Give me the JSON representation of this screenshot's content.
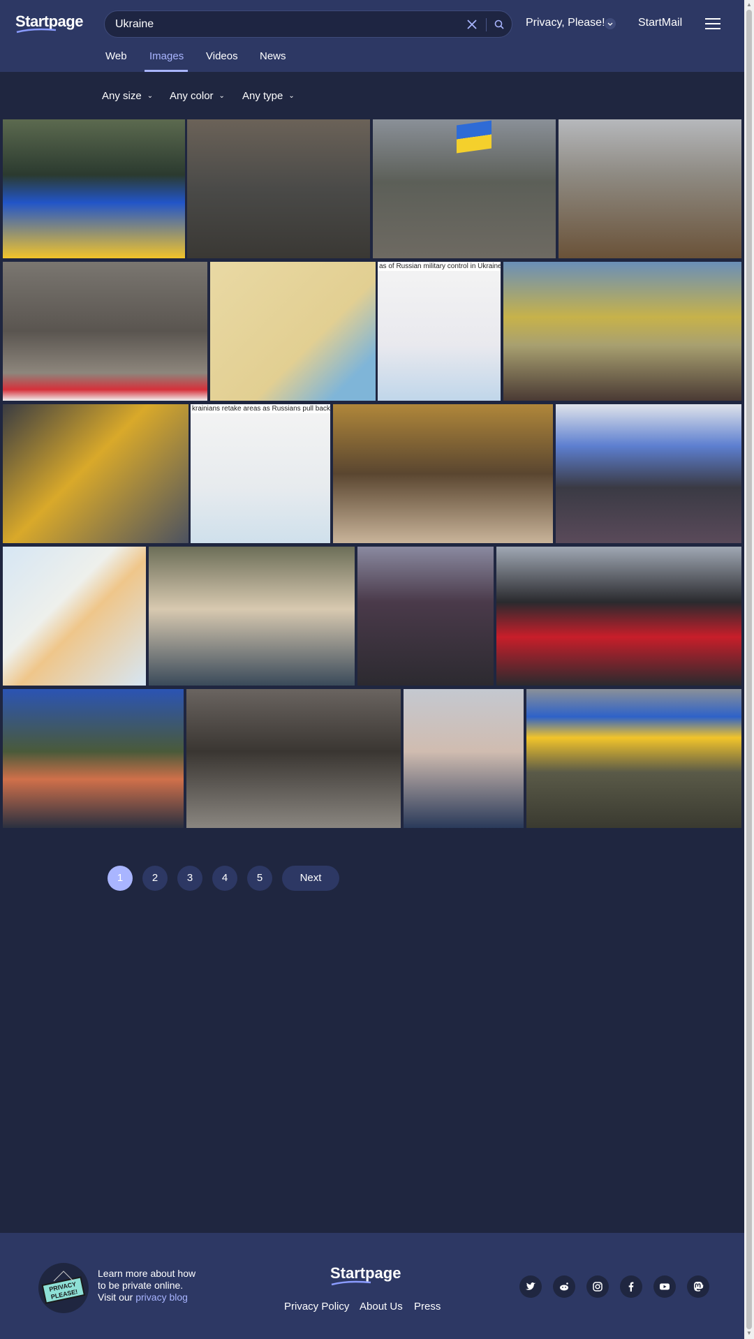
{
  "header": {
    "logo": "Startpage",
    "search": {
      "value": "Ukraine"
    },
    "privacy_menu": "Privacy, Please!",
    "startmail": "StartMail"
  },
  "tabs": [
    {
      "label": "Web",
      "active": false
    },
    {
      "label": "Images",
      "active": true
    },
    {
      "label": "Videos",
      "active": false
    },
    {
      "label": "News",
      "active": false
    }
  ],
  "filters": {
    "size": "Any size",
    "color": "Any color",
    "type": "Any type"
  },
  "images": {
    "map1_caption": "as of Russian military control in Ukraine",
    "map2_caption": "krainians retake areas as Russians pull back"
  },
  "pagination": {
    "pages": [
      "1",
      "2",
      "3",
      "4",
      "5"
    ],
    "current": "1",
    "next": "Next"
  },
  "footer": {
    "badge_text": "PRIVACY PLEASE!",
    "blurb_line1": "Learn more about how",
    "blurb_line2": "to be private online.",
    "blurb_line3": "Visit our",
    "blog_link": "privacy blog",
    "logo": "Startpage",
    "links": [
      "Privacy Policy",
      "About Us",
      "Press"
    ],
    "social_icons": [
      "twitter-icon",
      "reddit-icon",
      "instagram-icon",
      "facebook-icon",
      "youtube-icon",
      "mastodon-icon"
    ]
  },
  "colors": {
    "header_bg": "#2d3864",
    "page_bg": "#1f2640",
    "accent": "#a9b5ff"
  }
}
